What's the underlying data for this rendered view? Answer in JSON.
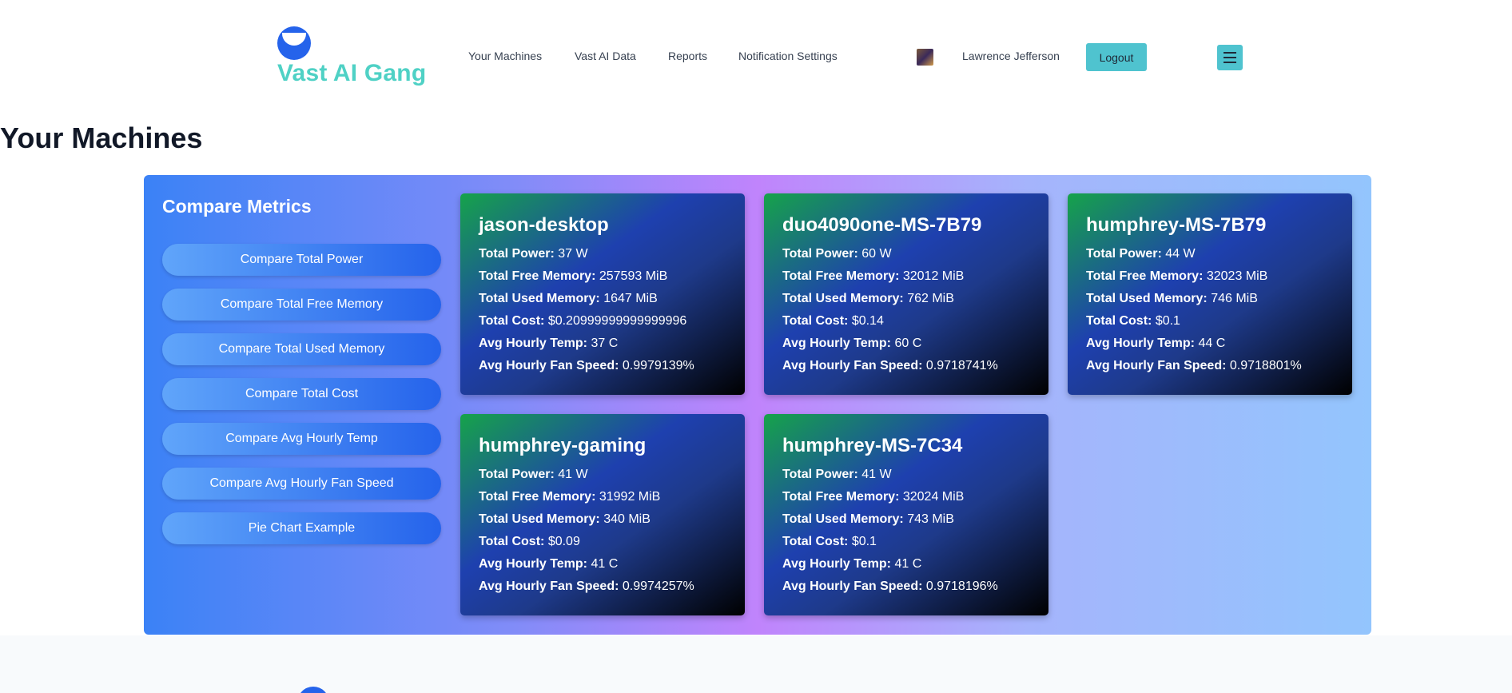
{
  "brand": {
    "name": "Vast AI Gang"
  },
  "nav": {
    "links": [
      "Your Machines",
      "Vast AI Data",
      "Reports",
      "Notification Settings"
    ],
    "user_name": "Lawrence Jefferson",
    "logout_label": "Logout"
  },
  "page": {
    "title": "Your Machines"
  },
  "compare": {
    "title": "Compare Metrics",
    "buttons": [
      "Compare Total Power",
      "Compare Total Free Memory",
      "Compare Total Used Memory",
      "Compare Total Cost",
      "Compare Avg Hourly Temp",
      "Compare Avg Hourly Fan Speed",
      "Pie Chart Example"
    ]
  },
  "metric_labels": {
    "power": "Total Power:",
    "free_memory": "Total Free Memory:",
    "used_memory": "Total Used Memory:",
    "cost": "Total Cost:",
    "temp": "Avg Hourly Temp:",
    "fan": "Avg Hourly Fan Speed:"
  },
  "machines": [
    {
      "name": "jason-desktop",
      "power": "37 W",
      "free_memory": "257593 MiB",
      "used_memory": "1647 MiB",
      "cost": "$0.20999999999999996",
      "temp": "37 C",
      "fan": "0.9979139%"
    },
    {
      "name": "duo4090one-MS-7B79",
      "power": "60 W",
      "free_memory": "32012 MiB",
      "used_memory": "762 MiB",
      "cost": "$0.14",
      "temp": "60 C",
      "fan": "0.9718741%"
    },
    {
      "name": "humphrey-MS-7B79",
      "power": "44 W",
      "free_memory": "32023 MiB",
      "used_memory": "746 MiB",
      "cost": "$0.1",
      "temp": "44 C",
      "fan": "0.9718801%"
    },
    {
      "name": "humphrey-gaming",
      "power": "41 W",
      "free_memory": "31992 MiB",
      "used_memory": "340 MiB",
      "cost": "$0.09",
      "temp": "41 C",
      "fan": "0.9974257%"
    },
    {
      "name": "humphrey-MS-7C34",
      "power": "41 W",
      "free_memory": "32024 MiB",
      "used_memory": "743 MiB",
      "cost": "$0.1",
      "temp": "41 C",
      "fan": "0.9718196%"
    }
  ]
}
